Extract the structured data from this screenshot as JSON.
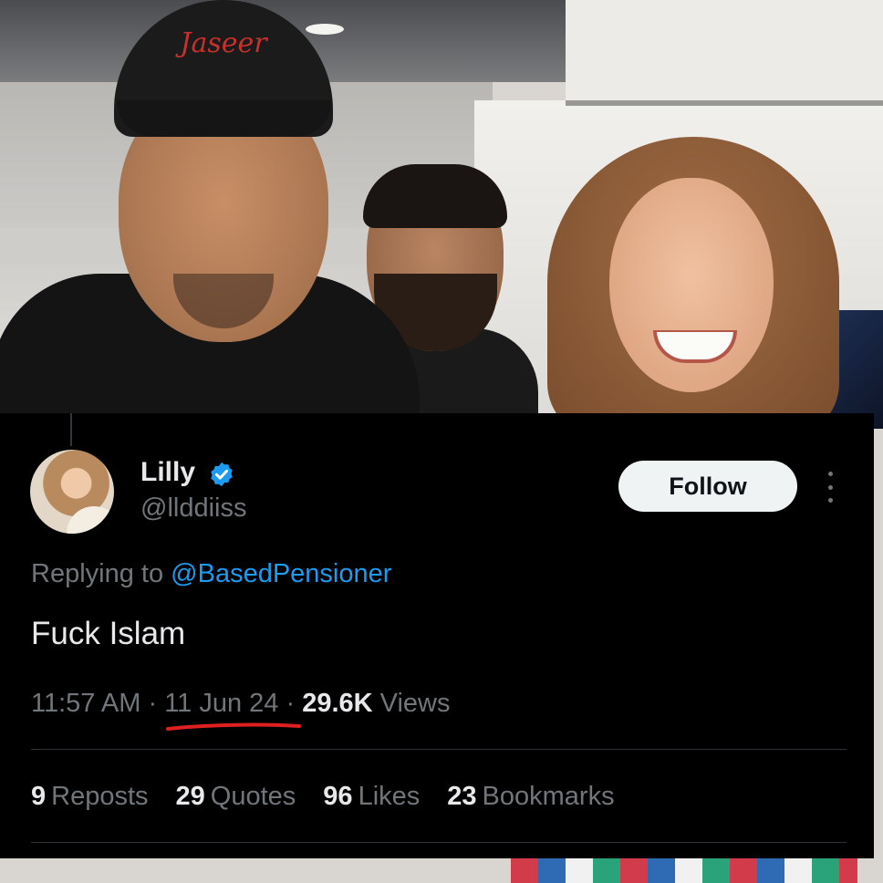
{
  "tweet": {
    "display_name": "Lilly",
    "handle": "@llddiiss",
    "verified_badge_icon": "verified-badge-icon",
    "accent_color": "#1d9bf0",
    "follow_label": "Follow",
    "more_icon": "more-options-icon",
    "reply_prefix": "Replying to",
    "reply_to": "@BasedPensioner",
    "text": "Fuck Islam",
    "time": "11:57 AM",
    "separator": "·",
    "date": "11 Jun 24",
    "views_count": "29.6K",
    "views_label": "Views",
    "date_underline_color": "#e02020",
    "stats": [
      {
        "count": "9",
        "label": "Reposts"
      },
      {
        "count": "29",
        "label": "Quotes"
      },
      {
        "count": "96",
        "label": "Likes"
      },
      {
        "count": "23",
        "label": "Bookmarks"
      }
    ]
  },
  "photo": {
    "cap_logo_text": "Jaseer"
  }
}
